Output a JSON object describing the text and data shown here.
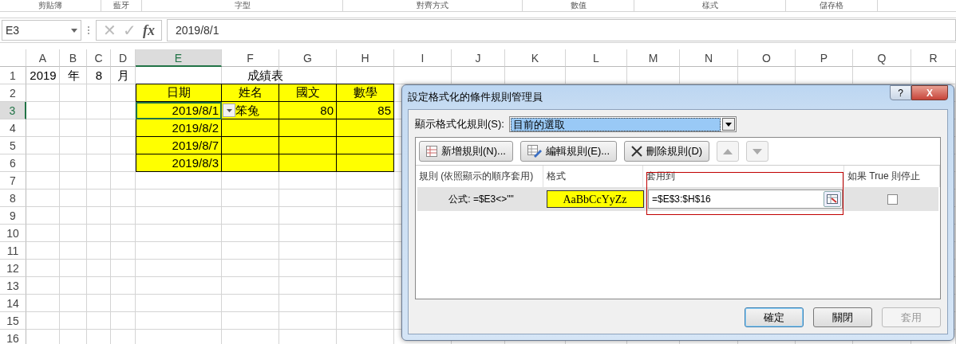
{
  "ribbon_groups": [
    "剪貼簿",
    "藍牙",
    "字型",
    "對齊方式",
    "數值",
    "樣式",
    "儲存格"
  ],
  "formula_bar": {
    "name_box": "E3",
    "cancel_button": {
      "label": "✕",
      "disabled": true
    },
    "enter_button": {
      "label": "✓",
      "disabled": true
    },
    "function_button": "fx",
    "formula": "2019/8/1"
  },
  "sheet": {
    "columns": [
      {
        "label": "A",
        "selected": false
      },
      {
        "label": "B",
        "selected": false
      },
      {
        "label": "C",
        "selected": false
      },
      {
        "label": "D",
        "selected": false
      },
      {
        "label": "E",
        "selected": true
      },
      {
        "label": "F",
        "selected": false
      },
      {
        "label": "G",
        "selected": false
      },
      {
        "label": "H",
        "selected": false
      },
      {
        "label": "I",
        "selected": false
      },
      {
        "label": "J",
        "selected": false
      },
      {
        "label": "K",
        "selected": false
      },
      {
        "label": "L",
        "selected": false
      },
      {
        "label": "M",
        "selected": false
      },
      {
        "label": "N",
        "selected": false
      },
      {
        "label": "O",
        "selected": false
      },
      {
        "label": "P",
        "selected": false
      },
      {
        "label": "Q",
        "selected": false
      },
      {
        "label": "R",
        "selected": false
      }
    ],
    "rows": [
      {
        "header": "1",
        "selected": false,
        "cells": {
          "A": {
            "text": "2019",
            "kind": "plain"
          },
          "B": {
            "text": "年",
            "kind": "plain"
          },
          "C": {
            "text": "8",
            "kind": "plain"
          },
          "D": {
            "text": "月",
            "kind": "plain"
          },
          "E:H": {
            "text": "成績表",
            "kind": "title"
          }
        }
      },
      {
        "header": "2",
        "selected": false,
        "cells": {
          "E": {
            "text": "日期",
            "kind": "table-header"
          },
          "F": {
            "text": "姓名",
            "kind": "table-header"
          },
          "G": {
            "text": "國文",
            "kind": "table-header"
          },
          "H": {
            "text": "數學",
            "kind": "table-header"
          }
        }
      },
      {
        "header": "3",
        "selected": true,
        "cells": {
          "E": {
            "text": "2019/8/1",
            "kind": "table",
            "selected": true
          },
          "F": {
            "text": "笨兔",
            "kind": "table",
            "selected": false,
            "dropdown_button": true
          },
          "G": {
            "text": "80",
            "kind": "table",
            "selected": false
          },
          "H": {
            "text": "85",
            "kind": "table",
            "selected": false
          }
        }
      },
      {
        "header": "4",
        "selected": false,
        "cells": {
          "E": {
            "text": "2019/8/2",
            "kind": "table"
          },
          "F": {
            "kind": "table"
          },
          "G": {
            "kind": "table"
          },
          "H": {
            "kind": "table"
          }
        }
      },
      {
        "header": "5",
        "selected": false,
        "cells": {
          "E": {
            "text": "2019/8/7",
            "kind": "table"
          },
          "F": {
            "kind": "table"
          },
          "G": {
            "kind": "table"
          },
          "H": {
            "kind": "table"
          }
        }
      },
      {
        "header": "6",
        "selected": false,
        "cells": {
          "E": {
            "text": "2019/8/3",
            "kind": "table"
          },
          "F": {
            "kind": "table"
          },
          "G": {
            "kind": "table"
          },
          "H": {
            "kind": "table"
          }
        }
      },
      {
        "header": "7",
        "selected": false
      },
      {
        "header": "8",
        "selected": false
      },
      {
        "header": "9",
        "selected": false
      },
      {
        "header": "10",
        "selected": false
      },
      {
        "header": "11",
        "selected": false
      },
      {
        "header": "12",
        "selected": false
      },
      {
        "header": "13",
        "selected": false
      },
      {
        "header": "14",
        "selected": false
      },
      {
        "header": "15",
        "selected": false
      },
      {
        "header": "16",
        "selected": false
      }
    ]
  },
  "dialog": {
    "title": "設定格式化的條件規則管理員",
    "help_button": "?",
    "close_button": "X",
    "show_rules_label": "顯示格式化規則(S):",
    "show_rules_value": "目前的選取",
    "toolbar": [
      {
        "kind": "new",
        "label": "新增規則(N)..."
      },
      {
        "kind": "edit",
        "label": "編輯規則(E)..."
      },
      {
        "kind": "delete",
        "label": "刪除規則(D)"
      },
      {
        "kind": "up",
        "disabled": true
      },
      {
        "kind": "down",
        "disabled": true
      }
    ],
    "rule_table": {
      "columns": [
        "規則 (依照顯示的順序套用)",
        "格式",
        "套用到",
        "如果 True 則停止"
      ],
      "applies_to_highlighted": true,
      "rows": [
        {
          "rule": "公式: =$E3<>\"\"",
          "format_preview": "AaBbCcYyZz",
          "applies_to": "=$E$3:$H$16",
          "stop_if_true": false,
          "selected": true
        }
      ]
    },
    "buttons": [
      {
        "label": "確定",
        "default": true,
        "disabled": false
      },
      {
        "label": "關閉",
        "default": false,
        "disabled": false
      },
      {
        "label": "套用",
        "default": false,
        "disabled": true
      }
    ]
  }
}
